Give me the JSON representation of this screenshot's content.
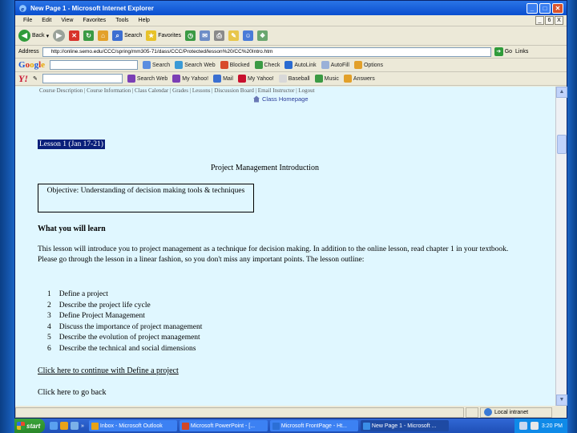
{
  "window": {
    "title": "New Page 1 - Microsoft Internet Explorer",
    "controls": [
      "_",
      "□",
      "✕"
    ]
  },
  "menu": [
    "File",
    "Edit",
    "View",
    "Favorites",
    "Tools",
    "Help"
  ],
  "mini_controls": [
    "_",
    "6",
    "X"
  ],
  "toolbar": {
    "back": "Back",
    "search": "Search",
    "favorites": "Favorites"
  },
  "address": {
    "label": "Address",
    "url": "http://online.semo.edu/CCC/spring/mm305-71/dass/CCC/Protected/lesson%20/CC%20Intro.htm",
    "go": "Go",
    "links": "Links"
  },
  "google": {
    "logo_g": "G",
    "logo_o1": "o",
    "logo_o2": "o",
    "logo_g2": "g",
    "logo_l": "l",
    "logo_e": "e",
    "items": [
      "Search",
      "Search Web",
      "Blocked",
      "Check",
      "AutoLink",
      "AutoFill",
      "Options"
    ]
  },
  "yahoo": {
    "logo": "Y!",
    "items": [
      "Search Web",
      "My Yahoo!",
      "Mail",
      "My Yahoo!",
      "Baseball",
      "Music",
      "Answers"
    ]
  },
  "page": {
    "top_nav": "Course Description | Course Information | Class Calendar | Grades | Lessons | Discussion Board | Email Instructor | Logout",
    "class_home": "Class Homepage",
    "lesson_title": "Lesson 1 (Jan 17-21)",
    "section_title": "Project Management Introduction",
    "objective": "Objective: Understanding of decision making tools & techniques",
    "what_you_will_learn": "What you will learn",
    "intro": "This lesson will introduce you to project management as a technique for decision making. In addition to the online lesson, read chapter 1 in your textbook.  Please go through the lesson in a linear fashion, so you don't miss any important points. The lesson outline:",
    "outline": [
      {
        "num": "1",
        "text": "Define a project"
      },
      {
        "num": "2",
        "text": "Describe the project life cycle"
      },
      {
        "num": "3",
        "text": "Define Project Management"
      },
      {
        "num": "4",
        "text": "Discuss the importance of project management"
      },
      {
        "num": "5",
        "text": "Describe the evolution of project management"
      },
      {
        "num": "6",
        "text": "Describe the technical and social dimensions"
      }
    ],
    "continue_link": "Click here to continue with Define a project",
    "back_link": "Click here to go back"
  },
  "status": {
    "zone": "Local intranet"
  },
  "taskbar": {
    "start": "start",
    "tasks": [
      {
        "label": "Inbox - Microsoft Outlook",
        "color": "#e8a317"
      },
      {
        "label": "Microsoft PowerPoint - [...",
        "color": "#d24726"
      },
      {
        "label": "Microsoft FrontPage - Ht...",
        "color": "#2b6fd6"
      },
      {
        "label": "New Page 1 - Microsoft ...",
        "color": "#3a8ee6"
      }
    ],
    "clock": "3:20 PM"
  }
}
